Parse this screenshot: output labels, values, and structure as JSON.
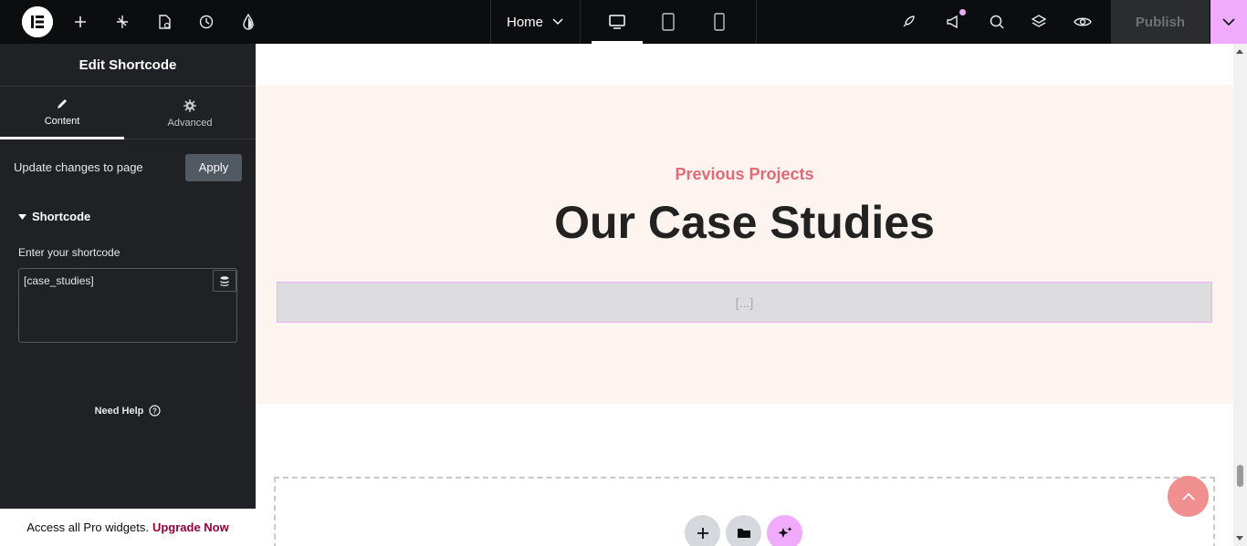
{
  "topbar": {
    "page_name": "Home",
    "publish_label": "Publish"
  },
  "panel": {
    "title": "Edit Shortcode",
    "tabs": [
      {
        "label": "Content",
        "icon": "pencil-icon",
        "active": true
      },
      {
        "label": "Advanced",
        "icon": "gear-icon",
        "active": false
      }
    ],
    "update_label": "Update changes to page",
    "apply_label": "Apply",
    "section_title": "Shortcode",
    "field_label": "Enter your shortcode",
    "field_value": "[case_studies]",
    "help_label": "Need Help",
    "promo_text": "Access all Pro widgets.",
    "promo_link": "Upgrade Now"
  },
  "canvas": {
    "eyebrow": "Previous Projects",
    "heading": "Our Case Studies",
    "shortcode_placeholder": "[...]"
  },
  "colors": {
    "accent": "#f0abfc",
    "eyebrow": "#e06a77",
    "section_bg": "#fdf3ef",
    "scroll_top": "#ef8f8f"
  }
}
